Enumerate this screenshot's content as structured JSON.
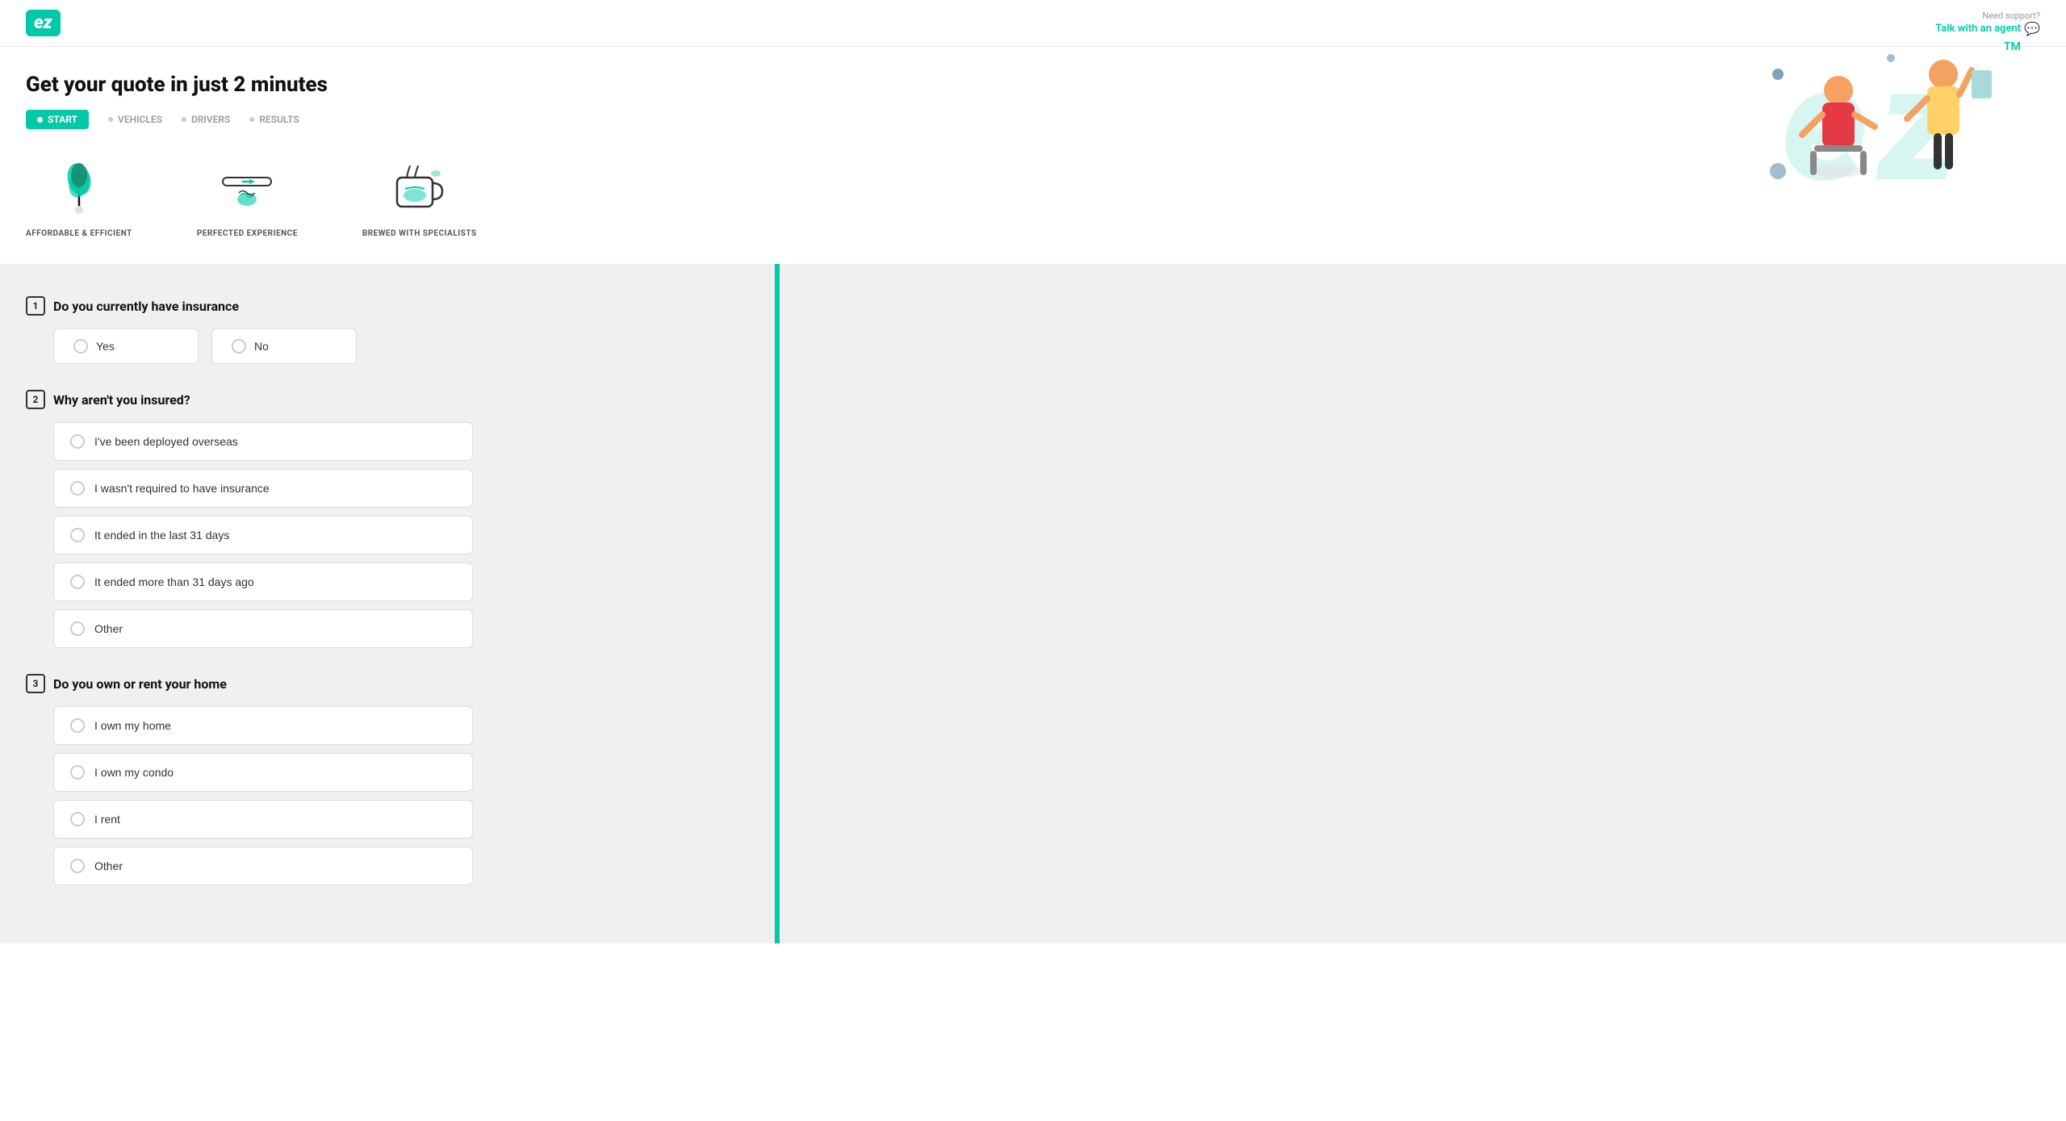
{
  "header": {
    "logo": "ez",
    "support_label": "Need support?",
    "talk_agent_label": "Talk with an agent"
  },
  "hero": {
    "title": "Get your quote in just 2 minutes",
    "steps": [
      {
        "label": "START",
        "active": true
      },
      {
        "label": "VEHICLES",
        "active": false
      },
      {
        "label": "DRIVERS",
        "active": false
      },
      {
        "label": "RESULTS",
        "active": false
      }
    ]
  },
  "features": [
    {
      "label": "AFFORDABLE & EFFICIENT"
    },
    {
      "label": "PERFECTED EXPERIENCE"
    },
    {
      "label": "BREWED WITH SPECIALISTS"
    }
  ],
  "questions": [
    {
      "number": "1",
      "text": "Do you currently have insurance",
      "type": "yes_no",
      "options": [
        "Yes",
        "No"
      ]
    },
    {
      "number": "2",
      "text": "Why aren't you insured?",
      "type": "radio_list",
      "options": [
        "I've been deployed overseas",
        "I wasn't required to have insurance",
        "It ended in the last 31 days",
        "It ended more than 31 days ago",
        "Other"
      ]
    },
    {
      "number": "3",
      "text": "Do you own or rent your home",
      "type": "radio_list",
      "options": [
        "I own my home",
        "I own my condo",
        "I rent",
        "Other"
      ]
    }
  ]
}
